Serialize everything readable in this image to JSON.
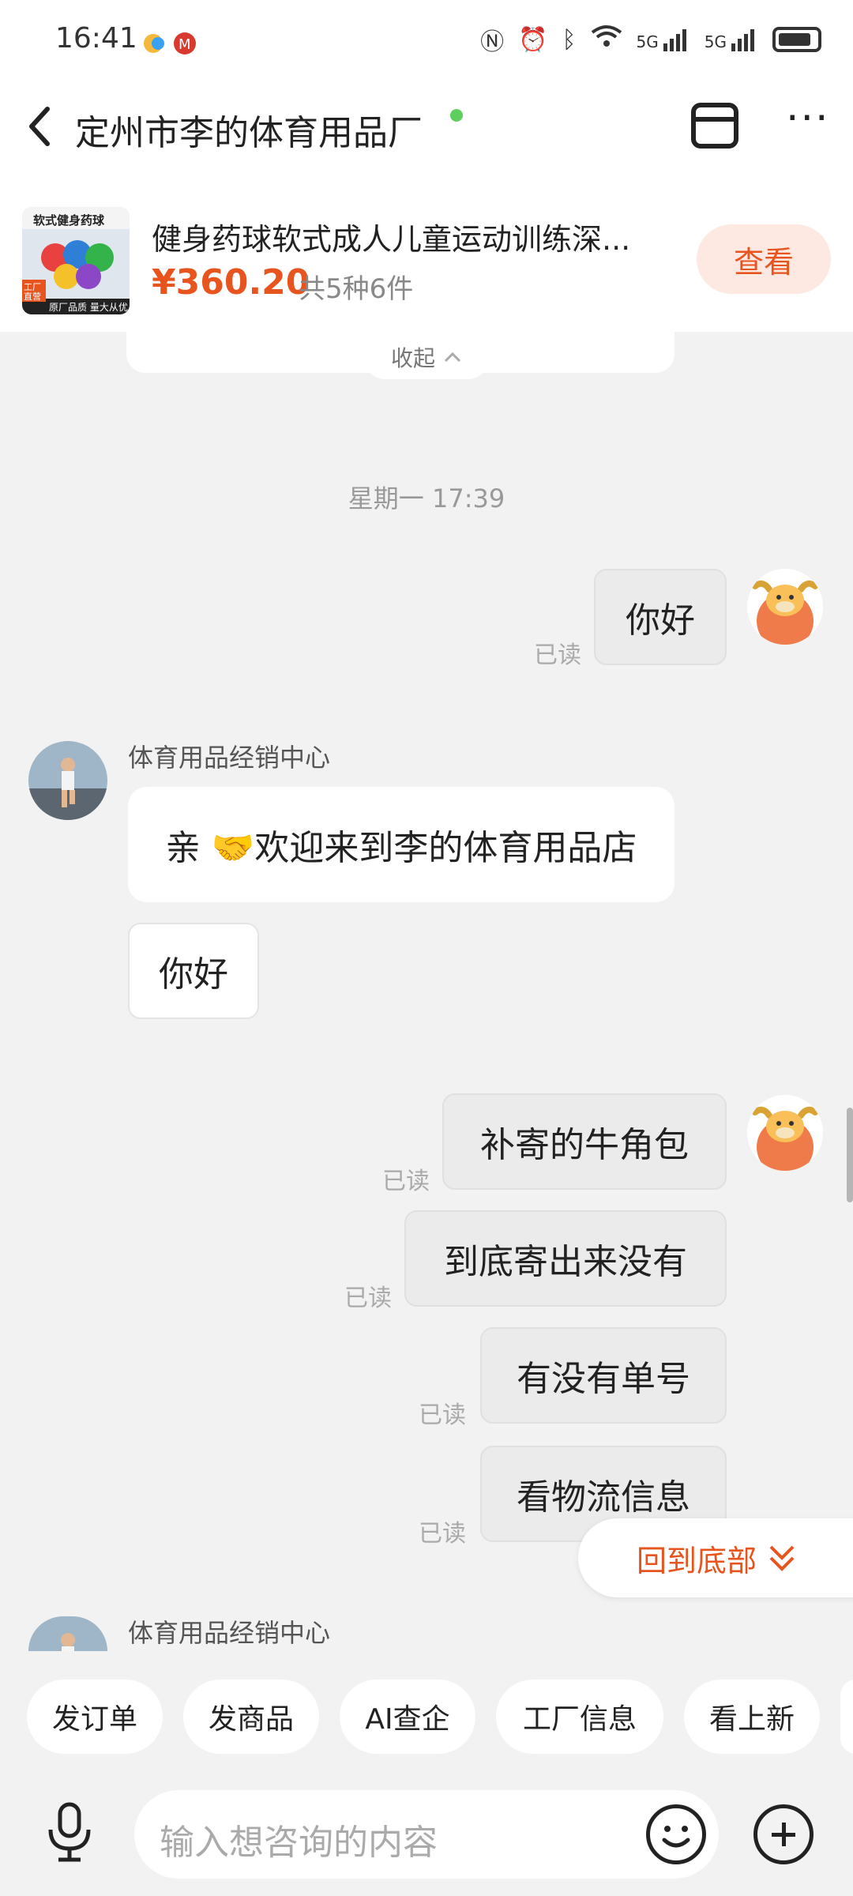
{
  "status_bar": {
    "time": "16:41",
    "right_icons": [
      "nfc-icon",
      "alarm-icon",
      "bluetooth-icon",
      "wifi-icon",
      "signal-5g-icon",
      "signal-5g-icon",
      "battery-icon"
    ],
    "network_labels": [
      "5G",
      "5G"
    ]
  },
  "header": {
    "title": "定州市李的体育用品厂",
    "online_color": "#5ccf5f"
  },
  "product": {
    "thumb_text_1": "软式健身药球",
    "thumb_text_2": "原厂品质 量大从优",
    "thumb_badge": "工厂直营",
    "title": "健身药球软式成人儿童运动训练深...",
    "price": "¥360.20",
    "count": "共5种6件",
    "view_label": "查看"
  },
  "collapse_label": "收起",
  "timestamp": "星期一 17:39",
  "messages": {
    "me_1": "你好",
    "them_sender": "体育用品经销中心",
    "them_1": "亲 🤝欢迎来到李的体育用品店",
    "them_2": "你好",
    "me_2": "补寄的牛角包",
    "me_3": "到底寄出来没有",
    "me_4": "有没有单号",
    "me_5": "看物流信息",
    "read_label": "已读",
    "them_sender_2": "体育用品经销中心"
  },
  "back_to_bottom": "回到底部",
  "quick_actions": [
    "发订单",
    "发商品",
    "AI查企",
    "工厂信息",
    "看上新"
  ],
  "input": {
    "placeholder": "输入想咨询的内容"
  },
  "colors": {
    "accent": "#e8541e",
    "accent_soft": "#fde9e2",
    "background": "#f2f2f2"
  }
}
